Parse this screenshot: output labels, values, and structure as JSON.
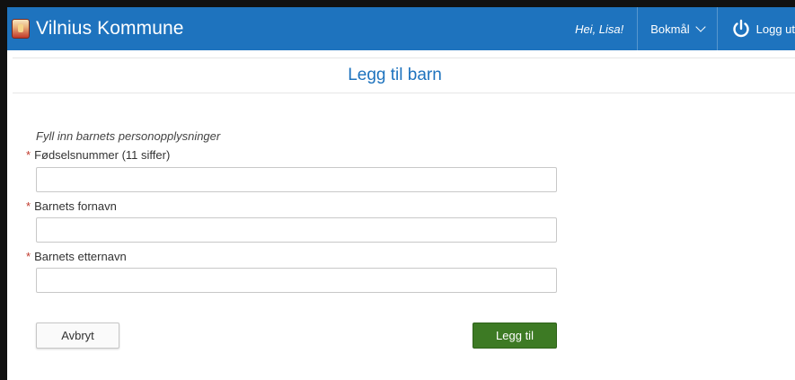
{
  "header": {
    "brand": "Vilnius Kommune",
    "greeting": "Hei, Lisa!",
    "language": "Bokmål",
    "logout_label": "Logg ut",
    "bar_color": "#1e73be"
  },
  "page": {
    "title": "Legg til barn"
  },
  "form": {
    "intro": "Fyll inn barnets personopplysninger",
    "required_marker": "*",
    "fields": [
      {
        "label": "Fødselsnummer (11 siffer)",
        "value": "",
        "placeholder": ""
      },
      {
        "label": "Barnets fornavn",
        "value": "",
        "placeholder": ""
      },
      {
        "label": "Barnets etternavn",
        "value": "",
        "placeholder": ""
      }
    ],
    "cancel_label": "Avbryt",
    "submit_label": "Legg til",
    "submit_color": "#3d7a24"
  },
  "icons": {
    "brand": "coat-of-arms-icon",
    "language": "chevron-down-icon",
    "logout": "power-icon"
  }
}
